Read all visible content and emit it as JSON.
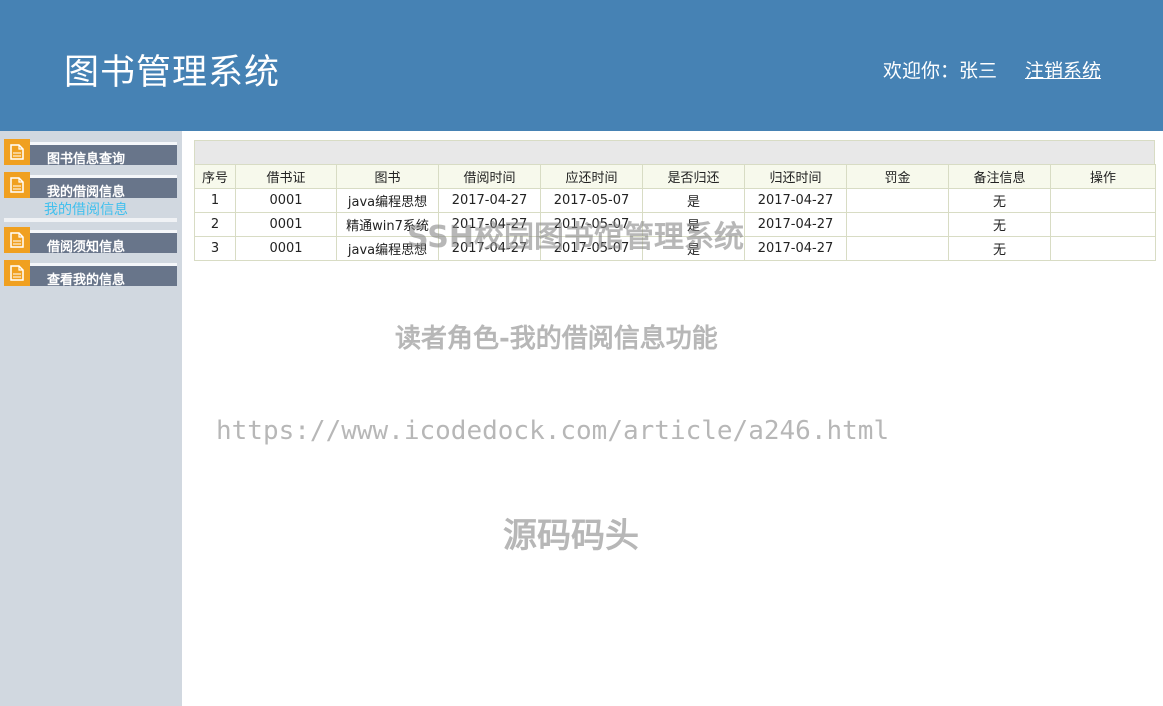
{
  "header": {
    "title": "图书管理系统",
    "welcome": "欢迎你：张三",
    "logout_label": "注销系统"
  },
  "sidebar": {
    "items": [
      {
        "label": "图书信息查询",
        "icon": "document-icon"
      },
      {
        "label": "我的借阅信息",
        "icon": "document-icon"
      },
      {
        "label": "借阅须知信息",
        "icon": "document-icon"
      },
      {
        "label": "查看我的信息",
        "icon": "document-icon"
      }
    ],
    "submenu_label": "我的借阅信息"
  },
  "table": {
    "columns": [
      "序号",
      "借书证",
      "图书",
      "借阅时间",
      "应还时间",
      "是否归还",
      "归还时间",
      "罚金",
      "备注信息",
      "操作"
    ],
    "rows": [
      [
        "1",
        "0001",
        "java编程思想",
        "2017-04-27",
        "2017-05-07",
        "是",
        "2017-04-27",
        "",
        "无",
        ""
      ],
      [
        "2",
        "0001",
        "精通win7系统",
        "2017-04-27",
        "2017-05-07",
        "是",
        "2017-04-27",
        "",
        "无",
        ""
      ],
      [
        "3",
        "0001",
        "java编程思想",
        "2017-04-27",
        "2017-05-07",
        "是",
        "2017-04-27",
        "",
        "无",
        ""
      ]
    ]
  },
  "watermarks": {
    "line1": "SSH校园图书馆管理系统",
    "line2": "读者角色-我的借阅信息功能",
    "line3": "https://www.icodedock.com/article/a246.html",
    "line4": "源码码头"
  },
  "colors": {
    "header_bg": "#4682b4",
    "sidebar_bg": "#d1d8e0",
    "menu_bar": "#68758a",
    "menu_icon": "#f0a020",
    "submenu_link": "#40c0ee"
  }
}
